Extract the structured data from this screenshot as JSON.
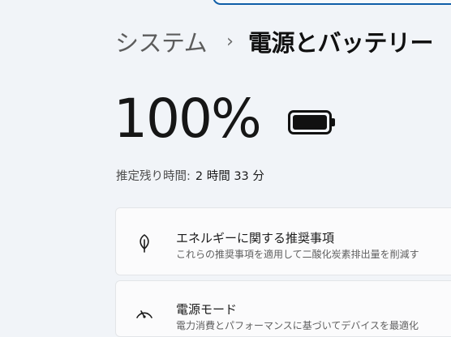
{
  "header": {
    "breadcrumb_parent": "システム",
    "breadcrumb_separator": "›",
    "page_title": "電源とバッテリー"
  },
  "battery": {
    "percent_text": "100%",
    "level_percent": 100,
    "remaining_label": "推定残り時間:",
    "remaining_value": "2 時間 33 分"
  },
  "cards": [
    {
      "icon": "leaf-icon",
      "title": "エネルギーに関する推奨事項",
      "description": "これらの推奨事項を適用して二酸化炭素排出量を削減す"
    },
    {
      "icon": "gauge-icon",
      "title": "電源モード",
      "description": "電力消費とパフォーマンスに基づいてデバイスを最適化"
    }
  ],
  "colors": {
    "background": "#f1f4f8",
    "card_background": "#fbfbfc",
    "accent": "#0f5ea8"
  }
}
